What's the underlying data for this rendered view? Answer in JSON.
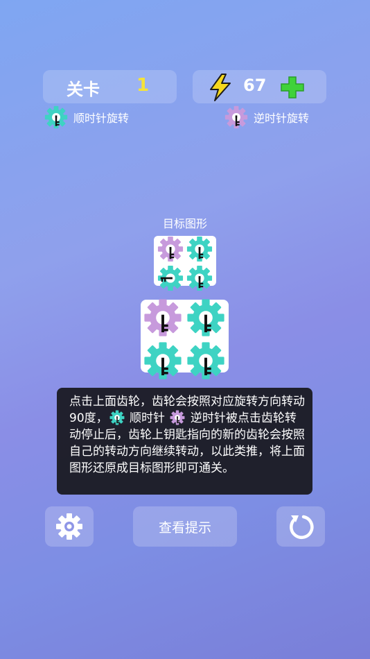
{
  "header": {
    "level_label": "关卡",
    "level_number": "1",
    "energy_value": "67"
  },
  "legend": {
    "clockwise_label": "顺时针旋转",
    "counterclockwise_label": "逆时针旋转"
  },
  "colors": {
    "teal_gear": "#3ed3c3",
    "purple_gear": "#c79adc",
    "level_number": "#f5e33a",
    "bolt": "#f5d81e",
    "plus": "#3fd23a"
  },
  "target": {
    "title": "目标图形",
    "gears": [
      {
        "color": "purple",
        "key": "down"
      },
      {
        "color": "teal",
        "key": "down"
      },
      {
        "color": "teal",
        "key": "left"
      },
      {
        "color": "teal",
        "key": "down"
      }
    ]
  },
  "board": {
    "gears": [
      {
        "color": "purple",
        "key": "down"
      },
      {
        "color": "teal",
        "key": "down"
      },
      {
        "color": "teal",
        "key": "down"
      },
      {
        "color": "teal",
        "key": "down"
      }
    ]
  },
  "help": {
    "part1": "点击上面齿轮，齿轮会按照对应旋转方向转动90度，",
    "cw_label": "顺时针",
    "ccw_label": "逆时针",
    "part2": "被点击齿轮转动停止后，齿轮上钥匙指向的新的齿轮会按照自己的转动方向继续转动，以此类推，将上面图形还原成目标图形即可通关。"
  },
  "buttons": {
    "hint_label": "查看提示"
  },
  "icons": {
    "settings": "gear-icon",
    "restart": "restart-icon",
    "energy": "lightning-icon",
    "add": "plus-icon"
  }
}
